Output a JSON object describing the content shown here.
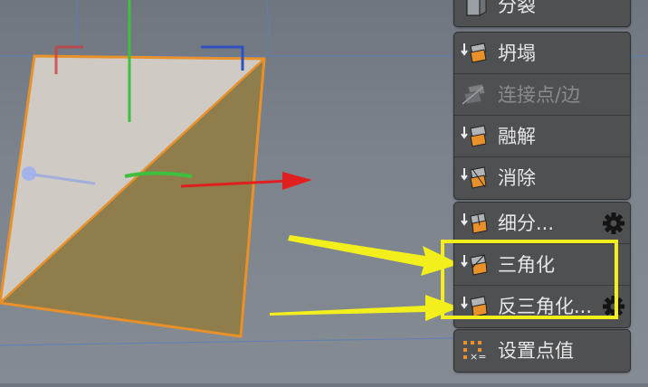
{
  "menu": {
    "group_top": {
      "items": [
        {
          "label": "分裂",
          "icon": "split-icon"
        }
      ]
    },
    "group_mid": {
      "items": [
        {
          "label": "坍塌",
          "icon": "collapse-icon"
        },
        {
          "label": "连接点/边",
          "icon": "connect-icon",
          "disabled": true
        },
        {
          "label": "融解",
          "icon": "melt-icon"
        },
        {
          "label": "消除",
          "icon": "dissolve-icon"
        }
      ]
    },
    "group_sub": {
      "items": [
        {
          "label": "细分...",
          "icon": "subdivide-icon",
          "has_settings": true
        },
        {
          "label": "三角化",
          "icon": "triangulate-icon"
        },
        {
          "label": "反三角化...",
          "icon": "untriangulate-icon",
          "has_settings": true
        }
      ]
    },
    "group_bottom": {
      "items": [
        {
          "label": "设置点值",
          "icon": "set-point-value-icon"
        }
      ]
    }
  },
  "annotation": {
    "highlight_color": "#f2ef1c"
  },
  "colors": {
    "accent_orange": "#e8902a",
    "axis_x": "#e02020",
    "axis_y": "#3fbf3f",
    "axis_z": "#3030b0"
  }
}
